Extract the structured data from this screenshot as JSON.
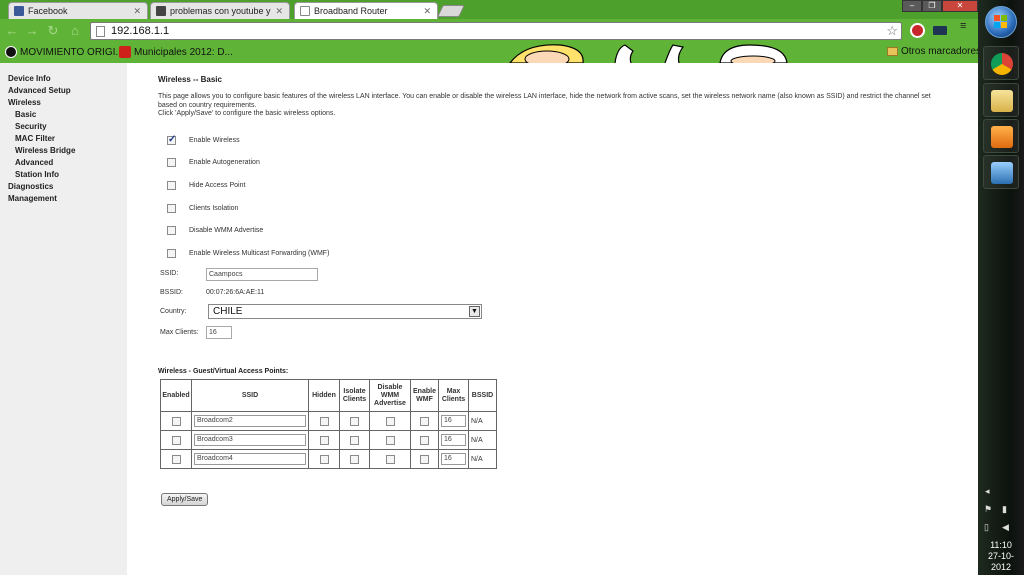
{
  "browser": {
    "tabs": [
      {
        "title": "Facebook",
        "color": "#3b5998"
      },
      {
        "title": "problemas con youtube y l",
        "color": "#444"
      },
      {
        "title": "Broadband Router",
        "color": "#ffffff"
      }
    ],
    "url": "192.168.1.1",
    "bookmarks": [
      {
        "label": "MOVIMIENTO ORIGI..."
      },
      {
        "label": "Municipales 2012: D..."
      }
    ],
    "other_bookmarks": "Otros marcadores",
    "theme_color": "#5fb437"
  },
  "nav": {
    "items": [
      {
        "label": "Device Info",
        "sub": false
      },
      {
        "label": "Advanced Setup",
        "sub": false
      },
      {
        "label": "Wireless",
        "sub": false
      },
      {
        "label": "Basic",
        "sub": true
      },
      {
        "label": "Security",
        "sub": true
      },
      {
        "label": "MAC Filter",
        "sub": true
      },
      {
        "label": "Wireless Bridge",
        "sub": true
      },
      {
        "label": "Advanced",
        "sub": true
      },
      {
        "label": "Station Info",
        "sub": true
      },
      {
        "label": "Diagnostics",
        "sub": false
      },
      {
        "label": "Management",
        "sub": false
      }
    ]
  },
  "main": {
    "title": "Wireless -- Basic",
    "intro_line1": "This page allows you to configure basic features of the wireless LAN interface. You can enable or disable the wireless LAN interface, hide the network from active scans, set the wireless network name (also known as SSID) and restrict the channel set based on country requirements.",
    "intro_line2": "Click 'Apply/Save' to configure the basic wireless options.",
    "options": [
      {
        "label": "Enable Wireless",
        "checked": true
      },
      {
        "label": "Enable Autogeneration",
        "checked": false
      },
      {
        "label": "Hide Access Point",
        "checked": false
      },
      {
        "label": "Clients Isolation",
        "checked": false
      },
      {
        "label": "Disable WMM Advertise",
        "checked": false
      },
      {
        "label": "Enable Wireless Multicast Forwarding (WMF)",
        "checked": false
      }
    ],
    "ssid_label": "SSID:",
    "ssid_value": "Caampocs",
    "bssid_label": "BSSID:",
    "bssid_value": "00:07:26:6A:AE:11",
    "country_label": "Country:",
    "country_value": "CHILE",
    "max_clients_label": "Max Clients:",
    "max_clients_value": "16"
  },
  "guest": {
    "title": "Wireless - Guest/Virtual Access Points:",
    "headers": [
      "Enabled",
      "SSID",
      "Hidden",
      "Isolate Clients",
      "Disable WMM Advertise",
      "Enable WMF",
      "Max Clients",
      "BSSID"
    ],
    "rows": [
      {
        "ssid": "Broadcom2",
        "max": "16",
        "bssid": "N/A"
      },
      {
        "ssid": "Broadcom3",
        "max": "16",
        "bssid": "N/A"
      },
      {
        "ssid": "Broadcom4",
        "max": "16",
        "bssid": "N/A"
      }
    ]
  },
  "apply_label": "Apply/Save",
  "taskbar": {
    "time": "11:10",
    "date": "27-10-2012"
  }
}
